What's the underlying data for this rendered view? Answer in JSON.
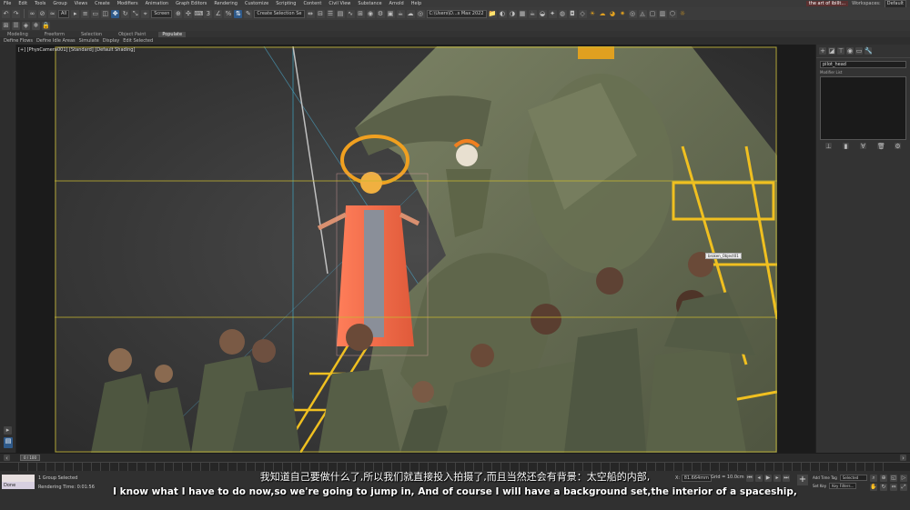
{
  "menubar": {
    "items": [
      "File",
      "Edit",
      "Tools",
      "Group",
      "Views",
      "Create",
      "Modifiers",
      "Animation",
      "Graph Editors",
      "Rendering",
      "Customize",
      "Scripting",
      "Content",
      "Civil View",
      "Substance",
      "Arnold",
      "Help"
    ],
    "tab_title": "the art of ibillt...",
    "workspaces_label": "Workspaces:",
    "workspace_value": "Default"
  },
  "toolbar": {
    "filter_dropdown": "All",
    "view_dropdown": "Screen",
    "selection_set": "Create Selection Se",
    "project_path": "C:\\Users\\D...s Max 2022"
  },
  "ribbon": {
    "tabs": [
      "Modeling",
      "Freeform",
      "Selection",
      "Object Paint",
      "Populate"
    ],
    "active_tab": "Populate",
    "sub_items": [
      "Define Flows",
      "Define Idle Areas",
      "Simulate",
      "Display",
      "Edit Selected"
    ]
  },
  "viewport": {
    "label": "[+] [PhysCamera001] [Standard] [Default Shading]",
    "object_tag": "broken_Object01"
  },
  "command_panel": {
    "object_name": "pilot_head",
    "modifier_list_label": "Modifier List"
  },
  "timeline": {
    "frame_display": "0 / 100"
  },
  "statusbar": {
    "maxscript_value": "Done",
    "selection_status": "1 Group Selected",
    "render_time": "Rendering Time: 0:01:56",
    "x_label": "X:",
    "x_value": "81.664mm",
    "grid_label": "Grid = 10.0cm",
    "add_time_tag": "Add Time Tag",
    "set_key": "Set Key",
    "key_filter": "Selected",
    "key_filters_btn": "Key Filters..."
  },
  "subtitles": {
    "zh": "我知道自己要做什么了,所以我们就直接投入拍摄了,而且当然还会有背景：太空船的内部,",
    "en": "I know what I have to do now,so we're going to jump in, And of course I will have a background set,the interior of a spaceship,"
  },
  "colors": {
    "saint_robe": "#f07050",
    "halo": "#f0a020",
    "mech": "#6e7558",
    "soldier": "#4e5640",
    "scaffold": "#f0c020",
    "safe_frame": "#c8b830"
  }
}
